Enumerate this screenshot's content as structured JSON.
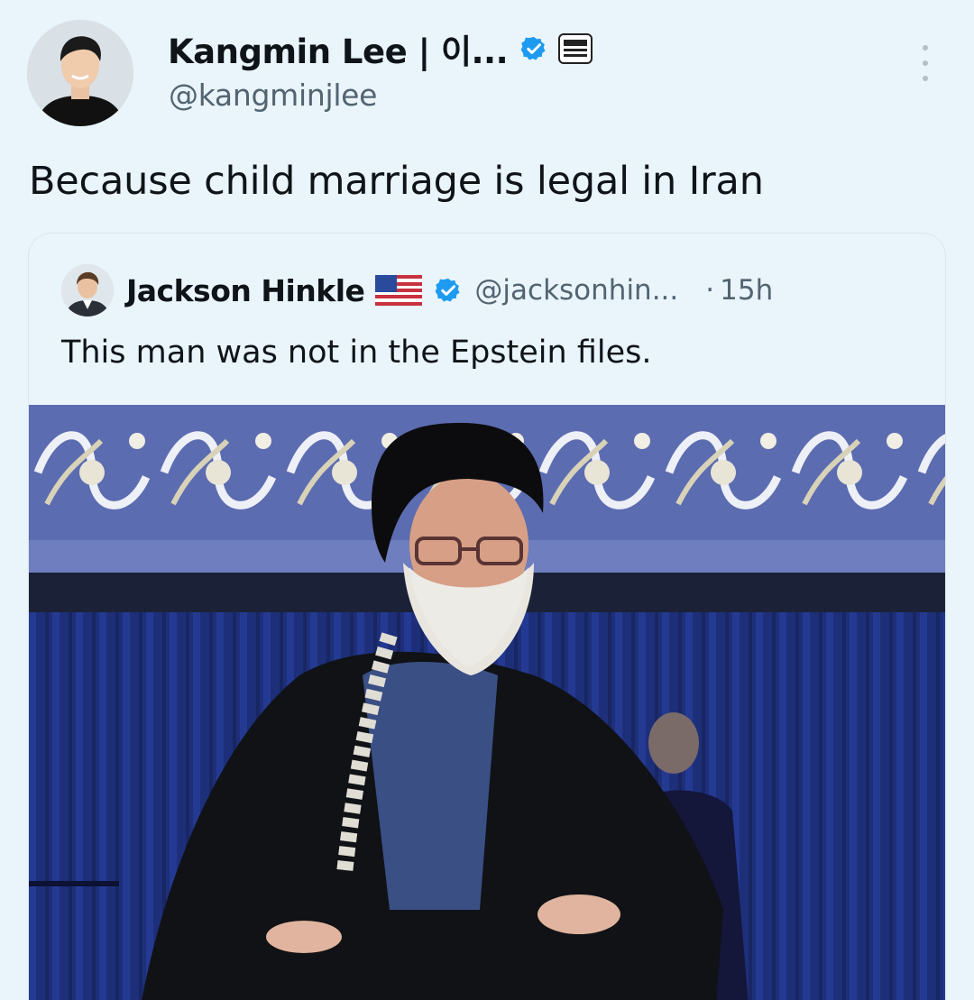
{
  "author": {
    "name": "Kangmin Lee | 이...",
    "handle": "@kangminjlee",
    "verified_color": "#1d9bf0",
    "avatar_icon": "profile-photo-icon",
    "affiliation_icon": "affiliation-badge-icon"
  },
  "tweet": {
    "text": "Because child marriage is legal in Iran"
  },
  "quoted": {
    "name": "Jackson Hinkle",
    "flag_icon": "us-flag-icon",
    "handle": "@jacksonhin...",
    "separator": "·",
    "time": "15h",
    "text": "This man was not in the Epstein files.",
    "media_icon": "photo-icon"
  },
  "colors": {
    "background": "#e9f4fb",
    "text": "#0f1419",
    "secondary_text": "#536471",
    "accent": "#1d9bf0"
  }
}
